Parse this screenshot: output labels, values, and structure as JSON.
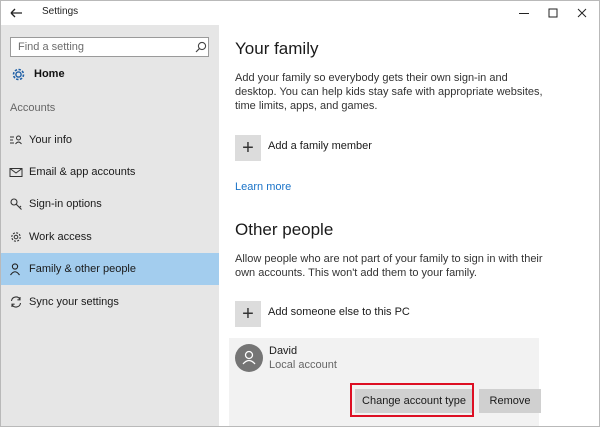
{
  "window": {
    "title": "Settings",
    "controls": [
      "minimize",
      "maximize",
      "close"
    ]
  },
  "sidebar": {
    "search": {
      "placeholder": "Find a setting",
      "icon": "search-icon"
    },
    "home": {
      "label": "Home",
      "icon": "gear-icon"
    },
    "section_label": "Accounts",
    "items": [
      {
        "label": "Your info",
        "icon": "person-card-icon",
        "selected": false
      },
      {
        "label": "Email & app accounts",
        "icon": "mail-icon",
        "selected": false
      },
      {
        "label": "Sign-in options",
        "icon": "key-icon",
        "selected": false
      },
      {
        "label": "Work access",
        "icon": "briefcase-icon",
        "selected": false
      },
      {
        "label": "Family & other people",
        "icon": "person-icon",
        "selected": true
      },
      {
        "label": "Sync your settings",
        "icon": "sync-icon",
        "selected": false
      }
    ]
  },
  "main": {
    "family": {
      "title": "Your family",
      "description": "Add your family so everybody gets their own sign-in and desktop. You can help kids stay safe with appropriate websites, time limits, apps, and games.",
      "add_label": "Add a family member",
      "learn_more": "Learn more"
    },
    "other": {
      "title": "Other people",
      "description": "Allow people who are not part of your family to sign in with their own accounts. This won't add them to your family.",
      "add_label": "Add someone else to this PC"
    },
    "account": {
      "name": "David",
      "type": "Local account",
      "change_label": "Change account type",
      "remove_label": "Remove"
    }
  },
  "colors": {
    "sidebar_bg": "#e6e6e6",
    "selected_bg": "#a3cdee",
    "link": "#1a73c8",
    "highlight": "#dd0f23",
    "button_bg": "#d0d0d0"
  }
}
